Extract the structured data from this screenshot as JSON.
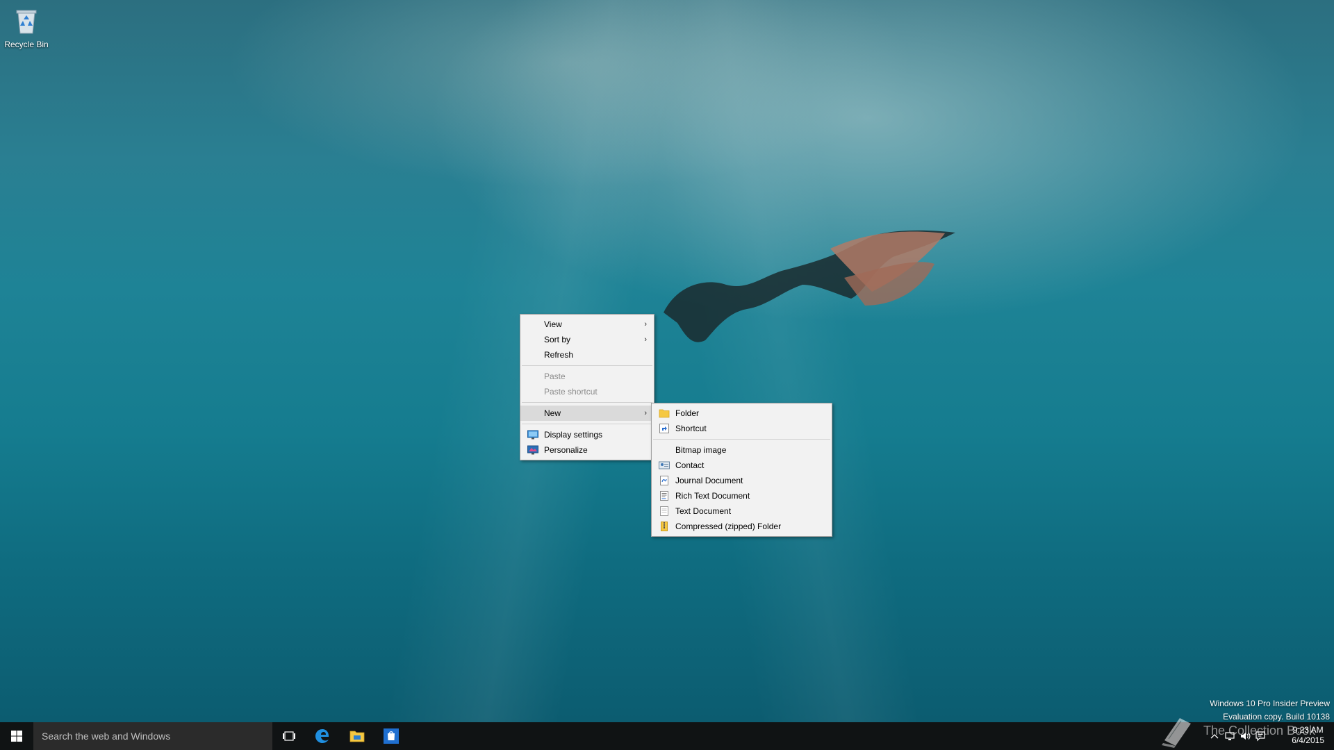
{
  "desktop": {
    "icons": [
      {
        "label": "Recycle Bin",
        "icon": "recycle-bin-icon"
      }
    ]
  },
  "context_menu": {
    "items": [
      {
        "label": "View",
        "has_submenu": true
      },
      {
        "label": "Sort by",
        "has_submenu": true
      },
      {
        "label": "Refresh"
      },
      {
        "label": "Paste",
        "disabled": true
      },
      {
        "label": "Paste shortcut",
        "disabled": true
      },
      {
        "label": "New",
        "has_submenu": true,
        "highlighted": true
      },
      {
        "label": "Display settings",
        "icon": "display-settings-icon"
      },
      {
        "label": "Personalize",
        "icon": "personalize-icon"
      }
    ],
    "submenu_arrow": "›"
  },
  "new_submenu": {
    "items": [
      {
        "label": "Folder",
        "icon": "folder-icon"
      },
      {
        "label": "Shortcut",
        "icon": "shortcut-icon"
      },
      {
        "label": "Bitmap image"
      },
      {
        "label": "Contact",
        "icon": "contact-icon"
      },
      {
        "label": "Journal Document",
        "icon": "journal-document-icon"
      },
      {
        "label": "Rich Text Document",
        "icon": "rich-text-document-icon"
      },
      {
        "label": "Text Document",
        "icon": "text-document-icon"
      },
      {
        "label": "Compressed (zipped) Folder",
        "icon": "zip-folder-icon"
      }
    ]
  },
  "taskbar": {
    "search_placeholder": "Search the web and Windows",
    "pinned": [
      "task-view-icon",
      "edge-icon",
      "file-explorer-icon",
      "store-icon"
    ],
    "clock_time": "9:23 AM",
    "clock_date": "6/4/2015"
  },
  "watermark": {
    "line1": "Windows 10 Pro Insider Preview",
    "line2": "Evaluation copy. Build 10138"
  },
  "brand": {
    "name": "The Collection Book"
  },
  "colors": {
    "taskbar": "#101314",
    "menu_bg": "#f2f2f2",
    "menu_hover": "#dadada",
    "accent_blue": "#0078d7"
  }
}
